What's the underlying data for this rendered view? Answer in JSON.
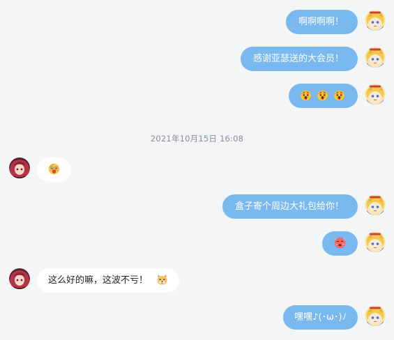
{
  "conversation": {
    "timestamp": "2021年10月15日 16:08",
    "messages": [
      {
        "side": "out",
        "text": "啊啊啊啊！"
      },
      {
        "side": "out",
        "text": "感谢亚瑟送的大会员！"
      },
      {
        "side": "out",
        "emojis": [
          "shocked-emoji",
          "shocked-emoji",
          "shocked-emoji"
        ]
      },
      {
        "side": "in",
        "emojis": [
          "surprised-emoji"
        ]
      },
      {
        "side": "out",
        "text": "盒子寄个周边大礼包给你！"
      },
      {
        "side": "out",
        "emojis": [
          "blushing-emoji"
        ]
      },
      {
        "side": "in",
        "text": "这么好的嘛，这波不亏！",
        "trailing_emoji": "doge-emoji"
      },
      {
        "side": "out",
        "text": "嘿嘿♪(･ω･)ﾉ"
      }
    ]
  },
  "colors": {
    "background": "#f4f5f7",
    "outgoing_bubble": "#7ab8f0",
    "incoming_bubble": "#ffffff",
    "timestamp_text": "#8a8e94"
  }
}
